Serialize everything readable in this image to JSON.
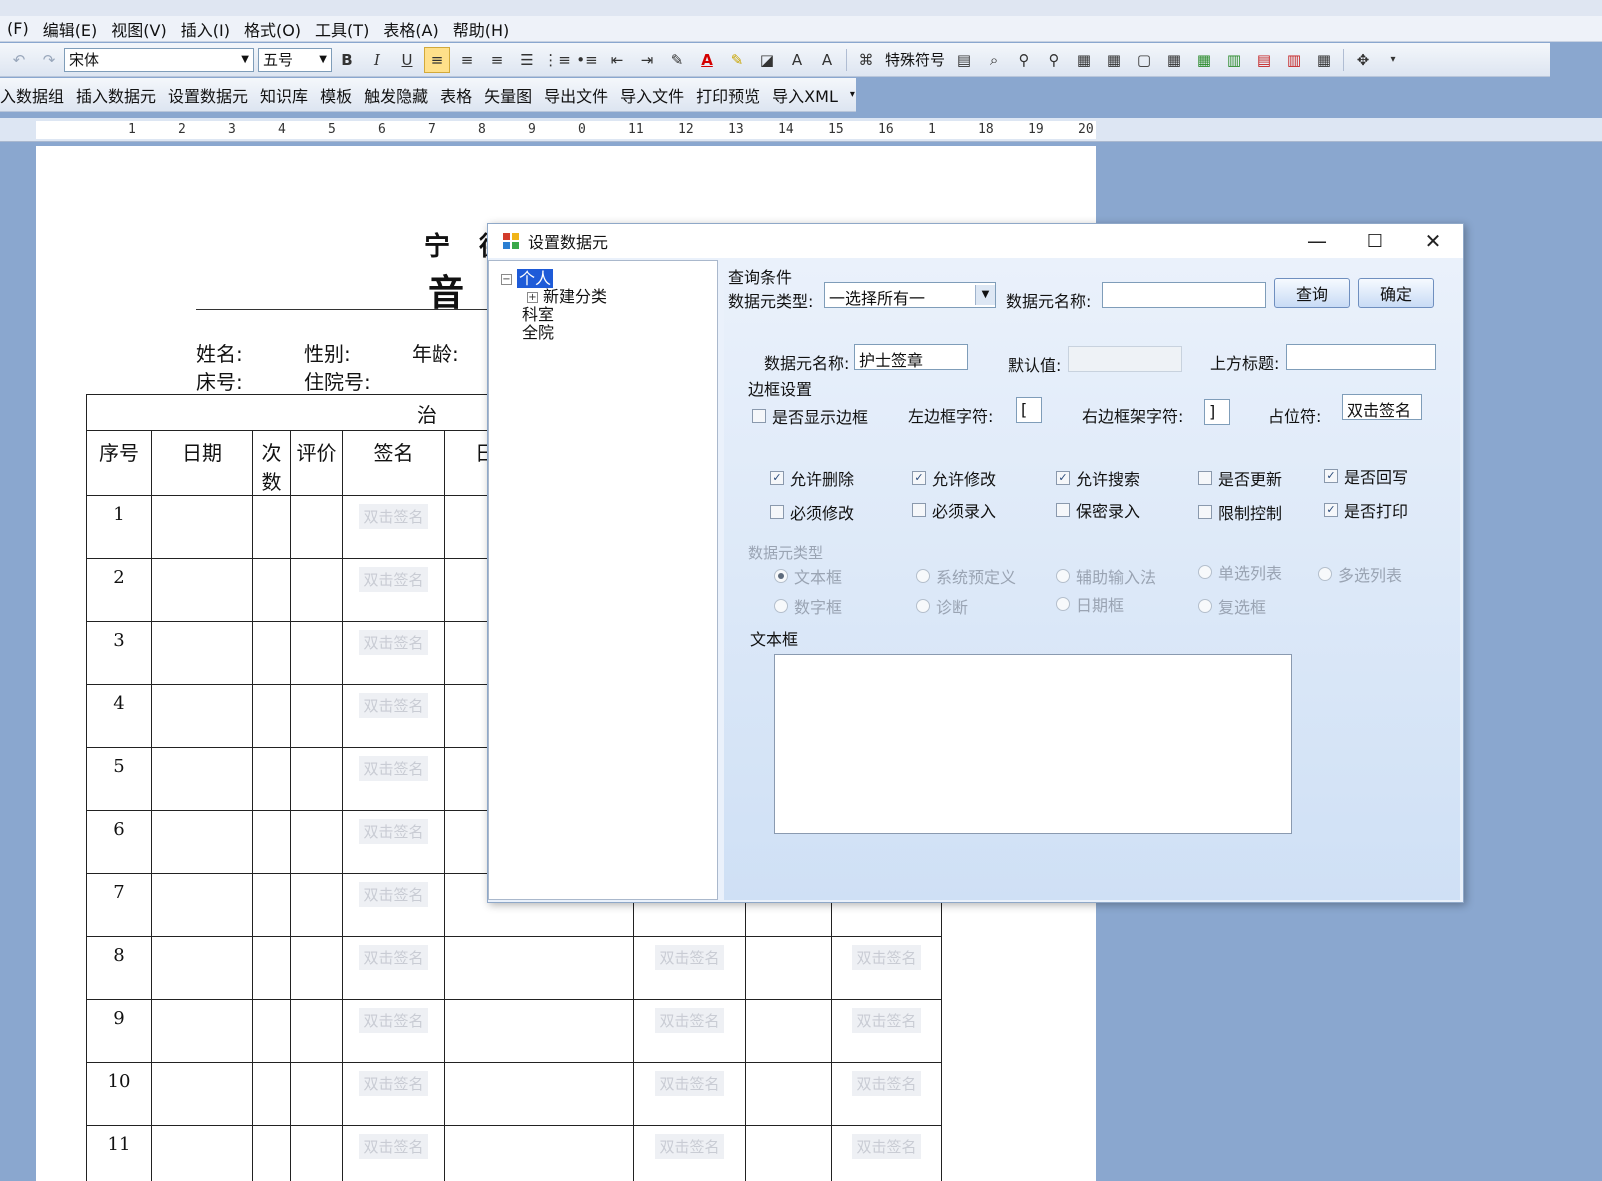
{
  "menubar": [
    "(F)",
    "编辑(E)",
    "视图(V)",
    "插入(I)",
    "格式(O)",
    "工具(T)",
    "表格(A)",
    "帮助(H)"
  ],
  "toolbar": {
    "font_name": "宋体",
    "font_size": "五号",
    "bold": "B",
    "italic": "I",
    "underline": "U",
    "special_symbol": "特殊符号"
  },
  "custom_toolbar": [
    "入数据组",
    "插入数据元",
    "设置数据元",
    "知识库",
    "模板",
    "触发隐藏",
    "表格",
    "矢量图",
    "导出文件",
    "导入文件",
    "打印预览",
    "导入XML"
  ],
  "ruler": [
    "1",
    "2",
    "3",
    "4",
    "5",
    "6",
    "7",
    "8",
    "9",
    "0",
    "11",
    "12",
    "13",
    "14",
    "15",
    "16",
    "1",
    "18",
    "19",
    "20"
  ],
  "document": {
    "title1": "宁 德",
    "title2": "音",
    "fields": {
      "name": "姓名:",
      "gender": "性别:",
      "age": "年龄:",
      "bed": "床号:",
      "admission": "住院号:"
    },
    "table_caption": "治",
    "headers": [
      "序号",
      "日期",
      "次数",
      "评价",
      "签名",
      "日"
    ],
    "rows": [
      "1",
      "2",
      "3",
      "4",
      "5",
      "6",
      "7",
      "8",
      "9",
      "10",
      "11"
    ],
    "placeholder": "双击签名"
  },
  "dialog": {
    "title": "设置数据元",
    "tree": {
      "personal": "个人",
      "new_category": "新建分类",
      "department": "科室",
      "hospital": "全院"
    },
    "query": {
      "section": "查询条件",
      "type_label": "数据元类型:",
      "type_value": "一选择所有一",
      "name_label": "数据元名称:",
      "name_value": "",
      "query_button": "查询",
      "ok_button": "确定"
    },
    "props": {
      "name_label": "数据元名称:",
      "name_value": "护士签章",
      "default_label": "默认值:",
      "default_value": "",
      "top_title_label": "上方标题:",
      "top_title_value": ""
    },
    "border": {
      "section": "边框设置",
      "show_border": "是否显示边框",
      "left_char_label": "左边框字符:",
      "left_char_value": "[",
      "right_char_label": "右边框架字符:",
      "right_char_value": "]",
      "placeholder_label": "占位符:",
      "placeholder_value": "双击签名"
    },
    "options": [
      {
        "label": "允许删除",
        "checked": true
      },
      {
        "label": "允许修改",
        "checked": true
      },
      {
        "label": "允许搜索",
        "checked": true
      },
      {
        "label": "是否更新",
        "checked": false
      },
      {
        "label": "是否回写",
        "checked": true
      },
      {
        "label": "必须修改",
        "checked": false
      },
      {
        "label": "必须录入",
        "checked": false
      },
      {
        "label": "保密录入",
        "checked": false
      },
      {
        "label": "限制控制",
        "checked": false
      },
      {
        "label": "是否打印",
        "checked": true
      }
    ],
    "type_section": "数据元类型",
    "types": [
      {
        "label": "文本框",
        "selected": true
      },
      {
        "label": "系统预定义",
        "selected": false
      },
      {
        "label": "辅助输入法",
        "selected": false
      },
      {
        "label": "单选列表",
        "selected": false
      },
      {
        "label": "多选列表",
        "selected": false
      },
      {
        "label": "数字框",
        "selected": false
      },
      {
        "label": "诊断",
        "selected": false
      },
      {
        "label": "日期框",
        "selected": false
      },
      {
        "label": "复选框",
        "selected": false
      }
    ],
    "textbox_label": "文本框",
    "textbox_value": "",
    "controls": {
      "minimize": "—",
      "maximize": "☐",
      "close": "✕"
    }
  },
  "colors": {
    "workspace": "#8aa7cf",
    "selection": "#1e5bd8",
    "font_color_bar": "#d40000"
  }
}
